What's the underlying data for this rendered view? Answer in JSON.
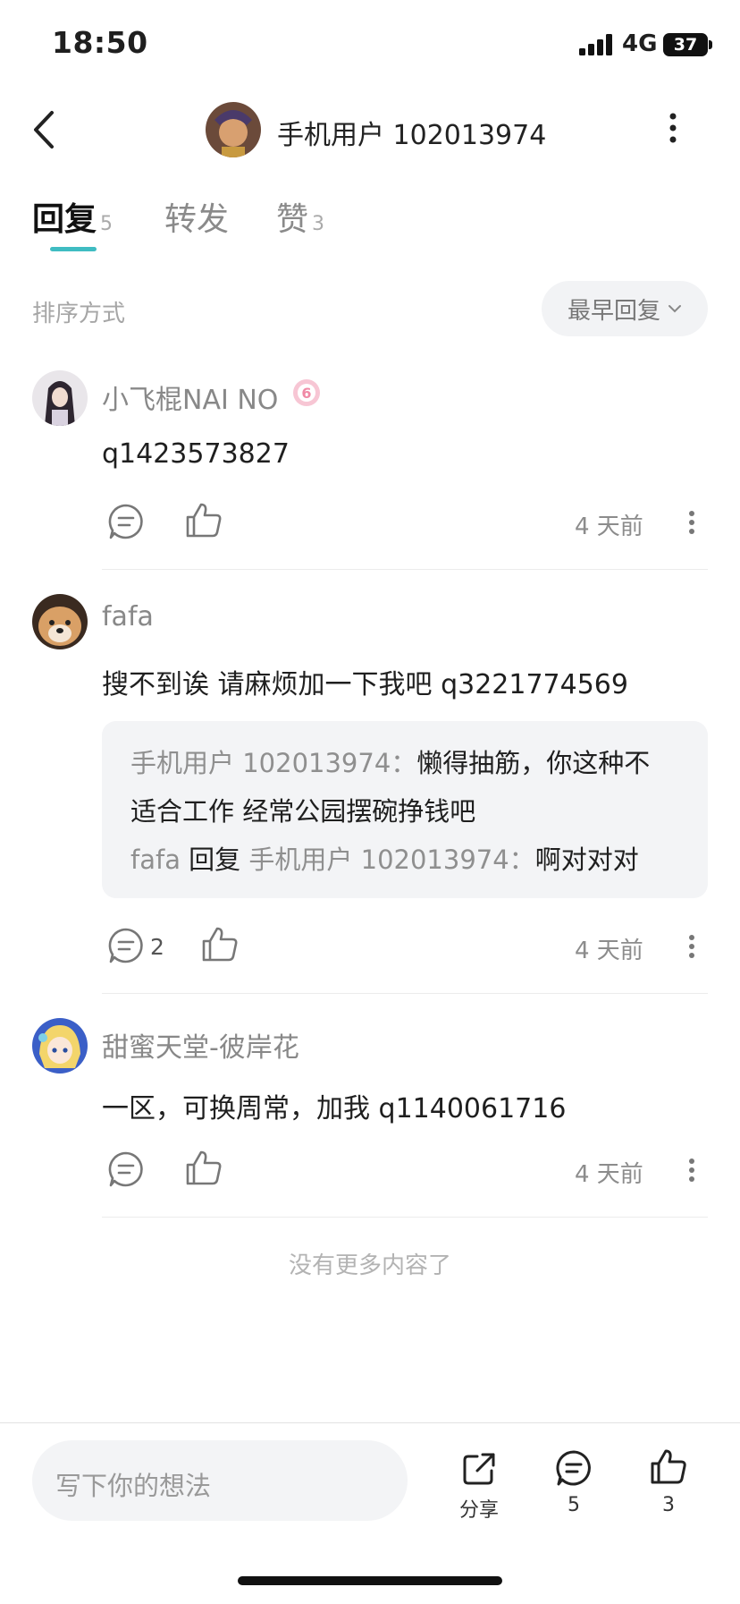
{
  "status_bar": {
    "time": "18:50",
    "network": "4G",
    "battery": "37"
  },
  "header": {
    "title": "手机用户 102013974"
  },
  "tabs": [
    {
      "label": "回复",
      "count": "5",
      "active": true
    },
    {
      "label": "转发",
      "count": "",
      "active": false
    },
    {
      "label": "赞",
      "count": "3",
      "active": false
    }
  ],
  "sort": {
    "label": "排序方式",
    "selected": "最早回复"
  },
  "comments": [
    {
      "user": "小飞棍NAI NO",
      "text": "q1423573827",
      "time": "4 天前",
      "replies": ""
    },
    {
      "user": "fafa",
      "text": "搜不到诶 请麻烦加一下我吧 q3221774569",
      "time": "4 天前",
      "replies": "2",
      "quote": {
        "user1": "手机用户 102013974：",
        "text1a": "懒得抽筋，你这种不",
        "text1b": "适合工作 经常公园摆碗挣钱吧",
        "user2": "fafa",
        "reply_word": " 回复 ",
        "target2": "手机用户 102013974：",
        "text2": "啊对对对"
      }
    },
    {
      "user": "甜蜜天堂-彼岸花",
      "text": "一区，可换周常，加我 q1140061716",
      "time": "4 天前",
      "replies": ""
    }
  ],
  "no_more": "没有更多内容了",
  "bottom": {
    "input_placeholder": "写下你的想法",
    "share_label": "分享",
    "comment_count": "5",
    "like_count": "3"
  },
  "colors": {
    "accent": "#3fbcc2",
    "badge": "#f08aa6"
  }
}
